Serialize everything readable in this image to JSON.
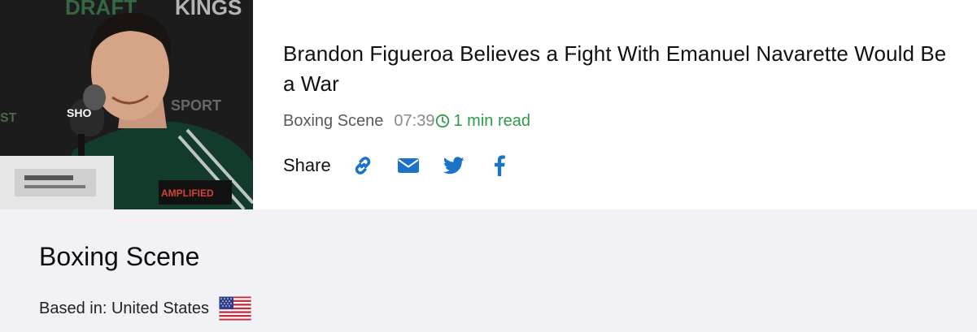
{
  "article": {
    "image_alt": "Brandon Figueroa at press conference",
    "headline": "Brandon Figueroa Believes a Fight With Emanuel Navarette Would Be a War",
    "source": "Boxing Scene",
    "time": "07:39",
    "read_time": "1 min read",
    "share": {
      "label": "Share",
      "buttons": [
        {
          "name": "copy-link",
          "icon": "link-icon"
        },
        {
          "name": "email",
          "icon": "envelope-icon"
        },
        {
          "name": "twitter",
          "icon": "twitter-icon"
        },
        {
          "name": "facebook",
          "icon": "facebook-icon"
        }
      ]
    }
  },
  "source_panel": {
    "title": "Boxing Scene",
    "based_in": "Based in: United States",
    "flag": "us-flag-icon"
  },
  "colors": {
    "share_icon": "#1a73c8",
    "read_time": "#2e9a4a",
    "panel_bg": "#f2f1f5"
  }
}
